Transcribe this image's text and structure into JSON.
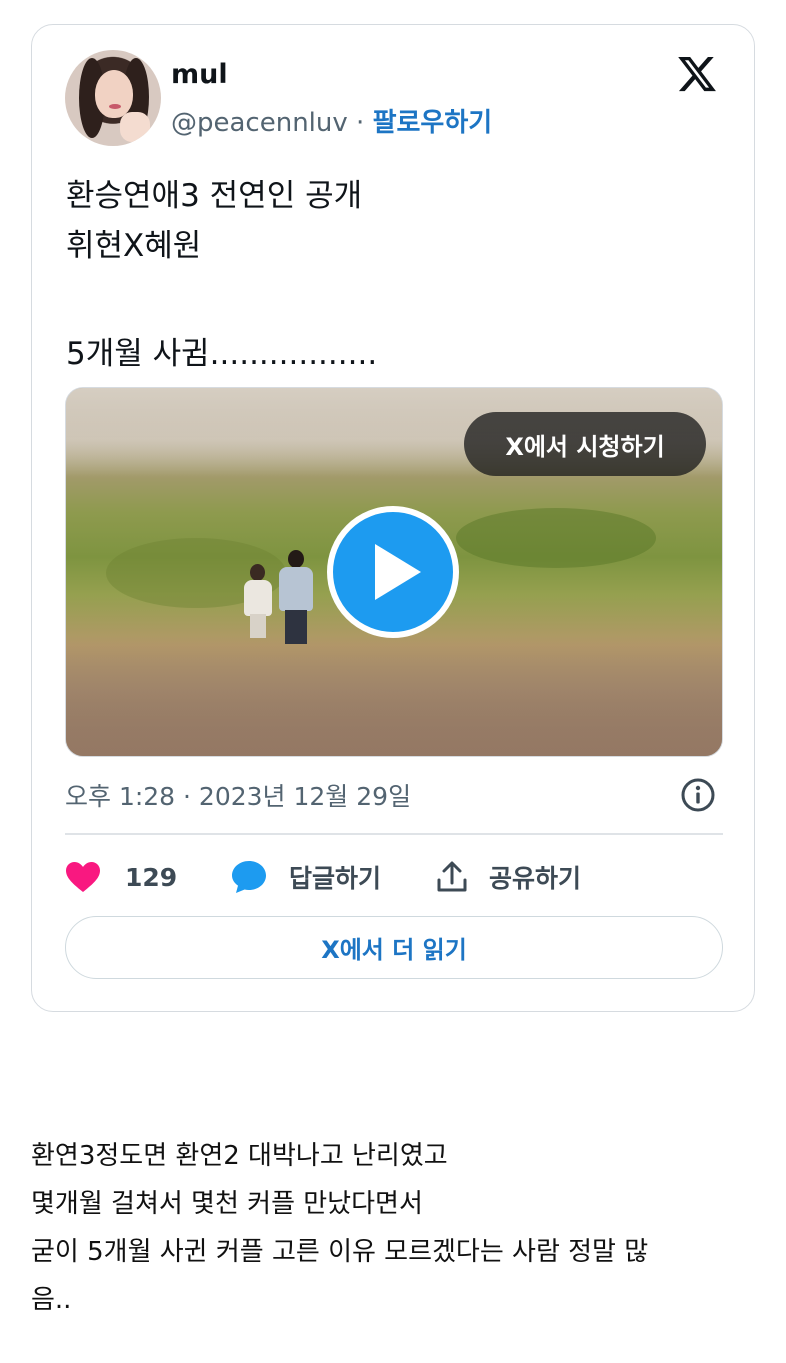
{
  "tweet": {
    "author_name": "mul",
    "handle": "@peacennluv",
    "separator": "·",
    "follow_label": "팔로우하기",
    "text_lines": [
      "환승연애3 전연인 공개",
      "휘현X혜원",
      "5개월 사귐................."
    ],
    "media": {
      "watch_label": "X에서 시청하기"
    },
    "timestamp": "오후 1:28 · 2023년 12월 29일",
    "likes": "129",
    "reply_label": "답글하기",
    "share_label": "공유하기",
    "read_more_label": "X에서 더 읽기",
    "icons": {
      "brand": "x-logo-icon",
      "like": "heart-icon",
      "reply": "speech-bubble-icon",
      "share": "share-upload-icon",
      "info": "info-icon",
      "play": "play-icon"
    },
    "colors": {
      "accent": "#1d75c4",
      "play_button": "#1d9bf0",
      "heart": "#f91880",
      "muted_text": "#536471"
    }
  },
  "post_body": {
    "lines": [
      "환연3정도면 환연2 대박나고 난리였고",
      "몇개월 걸쳐서 몇천 커플 만났다면서",
      "굳이 5개월 사귄 커플 고른 이유 모르겠다는 사람 정말 많",
      "음.."
    ]
  }
}
